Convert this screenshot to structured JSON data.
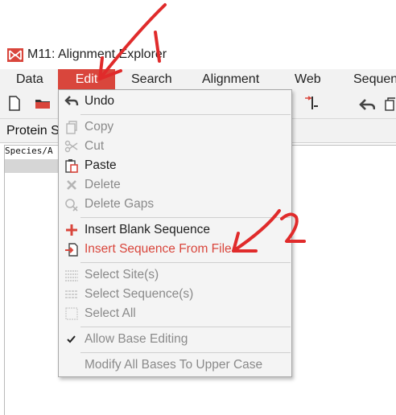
{
  "window": {
    "title": "M11: Alignment Explorer"
  },
  "colors": {
    "accent": "#d9463c",
    "annotation": "#e02b2b"
  },
  "menubar": {
    "items": [
      "Data",
      "Edit",
      "Search",
      "Alignment",
      "Web",
      "Sequen"
    ],
    "active": "Edit"
  },
  "tab": {
    "label": "Protein S"
  },
  "grid": {
    "header": "Species/A"
  },
  "edit_menu": {
    "undo": "Undo",
    "copy": "Copy",
    "cut": "Cut",
    "paste": "Paste",
    "delete": "Delete",
    "delete_gaps": "Delete Gaps",
    "insert_blank": "Insert Blank Sequence",
    "insert_from_file": "Insert Sequence From File",
    "select_sites": "Select Site(s)",
    "select_sequences": "Select Sequence(s)",
    "select_all": "Select All",
    "allow_base_editing": "Allow Base Editing",
    "modify_upper": "Modify All Bases To Upper Case"
  },
  "annotations": {
    "step1": "1",
    "step2": "2"
  }
}
